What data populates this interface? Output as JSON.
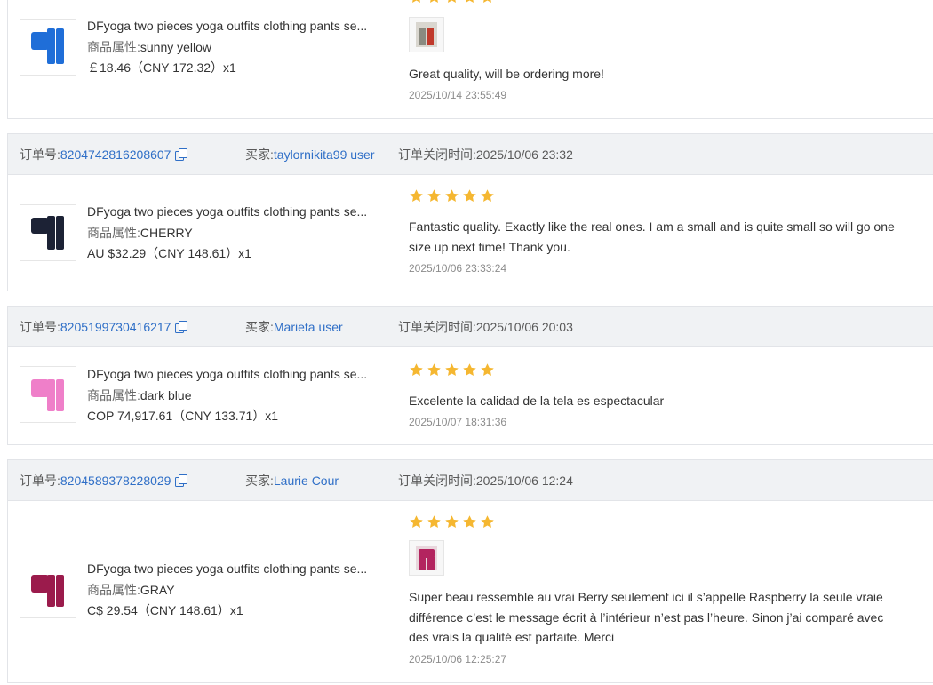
{
  "labels": {
    "order_no": "订单号:",
    "buyer": "买家:",
    "close_time_prefix": "订单关闭时间:",
    "attr_label": "商品属性:"
  },
  "colors": {
    "link": "#2f6fc7",
    "star": "#f5b731",
    "header_bg": "#f0f2f4"
  },
  "cards": [
    {
      "product": {
        "title": "DFyoga two pieces yoga outfits clothing pants se...",
        "attr": "sunny yellow",
        "price": "￡18.46（CNY  172.32）x1",
        "thumb_color": "#1f6ed8"
      },
      "review": {
        "stars": 5,
        "has_image": true,
        "image_color": "#8a8a80",
        "text": "Great quality, will be ordering more!",
        "time": "2025/10/14 23:55:49"
      }
    },
    {
      "order_id": "8204742816208607",
      "buyer": "taylornikita99 user",
      "close_time": "2025/10/06 23:32",
      "product": {
        "title": "DFyoga two pieces yoga outfits clothing pants se...",
        "attr": "CHERRY",
        "price": "AU $32.29（CNY  148.61）x1",
        "thumb_color": "#1c2235"
      },
      "review": {
        "stars": 5,
        "has_image": false,
        "text_lines": [
          "Fantastic quality. Exactly like the real ones. I am a small and is quite small so will go one",
          "size up next time! Thank you."
        ],
        "time": "2025/10/06 23:33:24"
      }
    },
    {
      "order_id": "8205199730416217",
      "buyer": "Marieta user",
      "close_time": "2025/10/06 20:03",
      "product": {
        "title": "DFyoga two pieces yoga outfits clothing pants se...",
        "attr": "dark blue",
        "price": "COP 74,917.61（CNY  133.71）x1",
        "thumb_color": "#ef7fc9"
      },
      "review": {
        "stars": 5,
        "has_image": false,
        "text": "Excelente la calidad de la tela es espectacular",
        "time": "2025/10/07 18:31:36"
      }
    },
    {
      "order_id": "8204589378228029",
      "buyer": "Laurie Cour",
      "close_time": "2025/10/06 12:24",
      "product": {
        "title": "DFyoga two pieces yoga outfits clothing pants se...",
        "attr": "GRAY",
        "price": "C$ 29.54（CNY  148.61）x1",
        "thumb_color": "#9b1b4c"
      },
      "review": {
        "stars": 5,
        "has_image": true,
        "image_color": "#b3245f",
        "text_lines": [
          "Super beau ressemble au vrai Berry seulement ici il s’appelle Raspberry la seule vraie",
          "différence c’est le message écrit à l’intérieur n’est pas l’heure. Sinon j’ai comparé avec",
          "des vrais la qualité est parfaite. Merci"
        ],
        "time": "2025/10/06 12:25:27"
      }
    }
  ]
}
